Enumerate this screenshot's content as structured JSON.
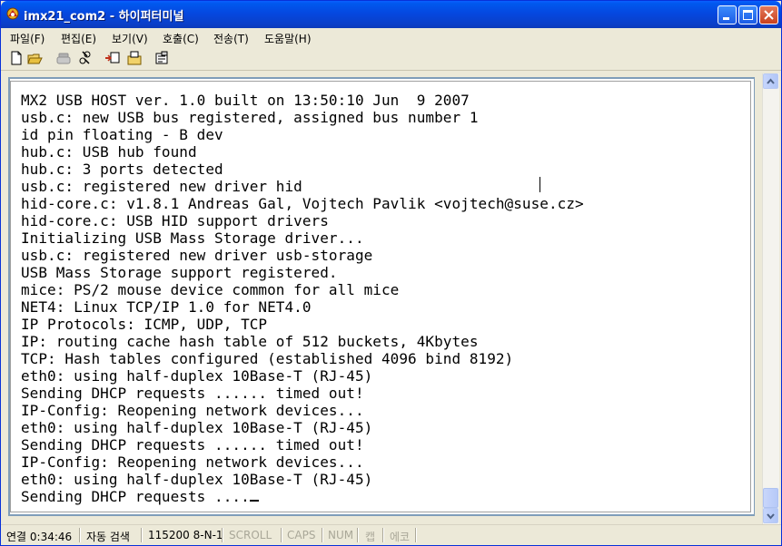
{
  "window": {
    "title": "imx21_com2 - 하이퍼터미널"
  },
  "menu": [
    {
      "label": "파일(F)"
    },
    {
      "label": "편집(E)"
    },
    {
      "label": "보기(V)"
    },
    {
      "label": "호출(C)"
    },
    {
      "label": "전송(T)"
    },
    {
      "label": "도움말(H)"
    }
  ],
  "toolbar": {
    "icons": [
      "new-file-icon",
      "open-folder-icon",
      "phone-icon",
      "disconnect-icon",
      "send-file-icon",
      "receive-file-icon",
      "properties-icon"
    ]
  },
  "terminal": {
    "lines": [
      "MX2 USB HOST ver. 1.0 built on 13:50:10 Jun  9 2007",
      "usb.c: new USB bus registered, assigned bus number 1",
      "id pin floating - B dev",
      "hub.c: USB hub found",
      "hub.c: 3 ports detected",
      "usb.c: registered new driver hid",
      "hid-core.c: v1.8.1 Andreas Gal, Vojtech Pavlik <vojtech@suse.cz>",
      "hid-core.c: USB HID support drivers",
      "Initializing USB Mass Storage driver...",
      "usb.c: registered new driver usb-storage",
      "USB Mass Storage support registered.",
      "mice: PS/2 mouse device common for all mice",
      "NET4: Linux TCP/IP 1.0 for NET4.0",
      "IP Protocols: ICMP, UDP, TCP",
      "IP: routing cache hash table of 512 buckets, 4Kbytes",
      "TCP: Hash tables configured (established 4096 bind 8192)",
      "eth0: using half-duplex 10Base-T (RJ-45)",
      "Sending DHCP requests ...... timed out!",
      "IP-Config: Reopening network devices...",
      "eth0: using half-duplex 10Base-T (RJ-45)",
      "Sending DHCP requests ...... timed out!",
      "IP-Config: Reopening network devices...",
      "eth0: using half-duplex 10Base-T (RJ-45)",
      "Sending DHCP requests ...."
    ]
  },
  "status": {
    "connected": "연결 0:34:46",
    "detect": "자동 검색",
    "settings": "115200 8-N-1",
    "scroll": "SCROLL",
    "caps": "CAPS",
    "num": "NUM",
    "capture": "캡",
    "echo": "에코"
  }
}
